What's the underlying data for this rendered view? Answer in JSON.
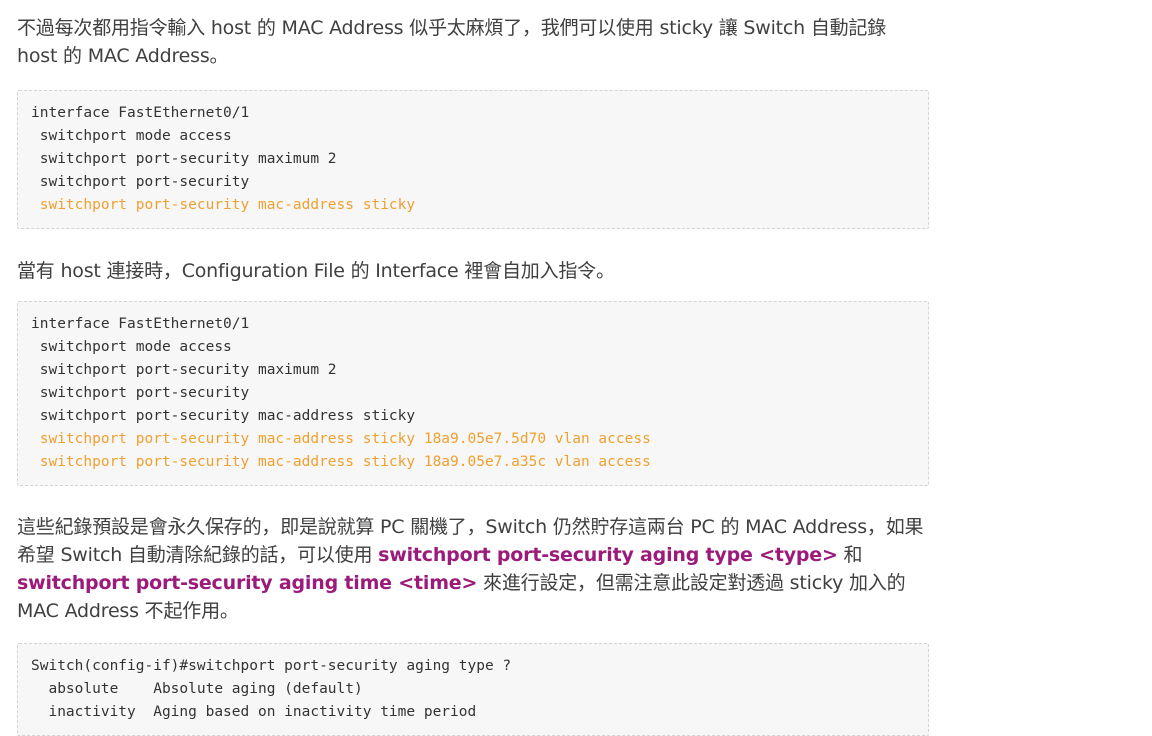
{
  "paragraphs": {
    "p1": "不過每次都用指令輸入 host 的 MAC Address 似乎太麻煩了，我們可以使用 sticky 讓 Switch 自動記錄 host 的 MAC Address。",
    "p2": "當有 host 連接時，Configuration File 的 Interface 裡會自加入指令。",
    "p3_a": "這些紀錄預設是會永久保存的，即是說就算 PC 關機了，Switch 仍然貯存這兩台 PC 的 MAC Address，如果希望 Switch 自動清除紀錄的話，可以使用 ",
    "p3_kw1": "switchport port-security aging type <type>",
    "p3_b": " 和 ",
    "p3_kw2": "switchport port-security aging time <time>",
    "p3_c": " 來進行設定，但需注意此設定對透過 sticky 加入的 MAC Address 不起作用。"
  },
  "code_blocks": {
    "block1": [
      "interface FastEthernet0/1",
      " switchport mode access",
      " switchport port-security maximum 2",
      " switchport port-security",
      " switchport port-security mac-address sticky"
    ],
    "block2": [
      "interface FastEthernet0/1",
      " switchport mode access",
      " switchport port-security maximum 2",
      " switchport port-security",
      " switchport port-security mac-address sticky",
      " switchport port-security mac-address sticky 18a9.05e7.5d70 vlan access",
      " switchport port-security mac-address sticky 18a9.05e7.a35c vlan access"
    ],
    "block3": [
      "Switch(config-if)#switchport port-security aging type ?",
      "  absolute    Absolute aging (default)",
      "  inactivity  Aging based on inactivity time period"
    ]
  },
  "colors": {
    "highlight": "#f0a030",
    "keyword": "#9b1a7a",
    "text": "#404040",
    "code_bg": "#f7f7f7"
  }
}
